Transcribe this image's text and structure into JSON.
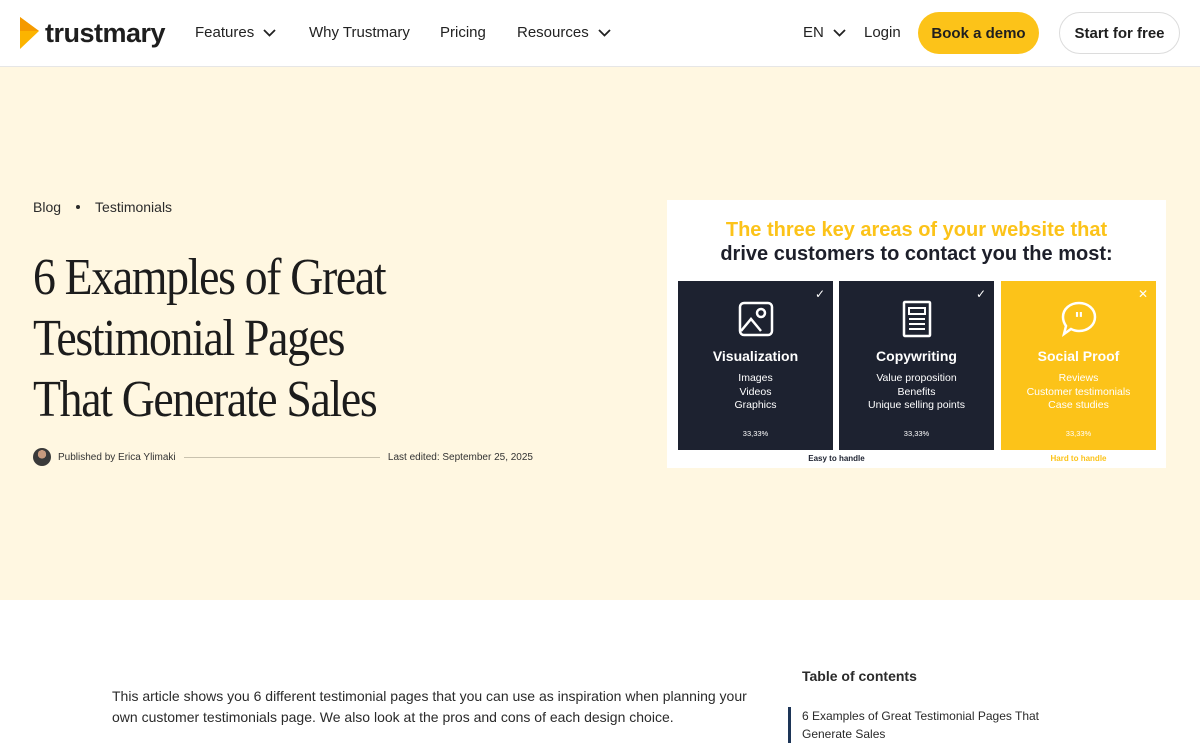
{
  "nav": {
    "brand": "trustmary",
    "items": [
      {
        "label": "Features",
        "has_dropdown": true
      },
      {
        "label": "Why Trustmary",
        "has_dropdown": false
      },
      {
        "label": "Pricing",
        "has_dropdown": false
      },
      {
        "label": "Resources",
        "has_dropdown": true
      }
    ],
    "language": "EN",
    "login": "Login",
    "demo_button": "Book a demo",
    "free_button": "Start for free"
  },
  "hero": {
    "breadcrumb": [
      "Blog",
      "Testimonials"
    ],
    "title": "6 Examples of Great Testimonial Pages That Generate Sales",
    "author": "Published by Erica Ylimaki",
    "edited": "Last edited: September 25, 2025"
  },
  "hero_image": {
    "heading_line1": "The three key areas of your website that",
    "heading_line2": "drive customers to contact you the most:",
    "panels": [
      {
        "title": "Visualization",
        "items": [
          "Images",
          "Videos",
          "Graphics"
        ],
        "percent": "33,33%",
        "mark": "✓",
        "icon": "image-icon"
      },
      {
        "title": "Copywriting",
        "items": [
          "Value proposition",
          "Benefits",
          "Unique selling points"
        ],
        "percent": "33,33%",
        "mark": "✓",
        "icon": "document-icon"
      },
      {
        "title": "Social Proof",
        "items": [
          "Reviews",
          "Customer testimonials",
          "Case studies"
        ],
        "percent": "33,33%",
        "mark": "✕",
        "icon": "quote-bubble-icon"
      }
    ],
    "footer_left": "Easy to handle",
    "footer_right": "Hard to handle",
    "colors": {
      "accent": "#fcc319",
      "dark": "#1d2230"
    }
  },
  "article": {
    "intro": "This article shows you 6 different testimonial pages that you can use as inspiration when planning your own customer testimonials page. We also look at the pros and cons of each design choice."
  },
  "toc": {
    "heading": "Table of contents",
    "items": [
      "6 Examples of Great Testimonial Pages That Generate Sales"
    ]
  },
  "colors": {
    "hero_bg": "#fff7e1",
    "brand_yellow": "#fcc319",
    "brand_orange": "#f5a200"
  }
}
